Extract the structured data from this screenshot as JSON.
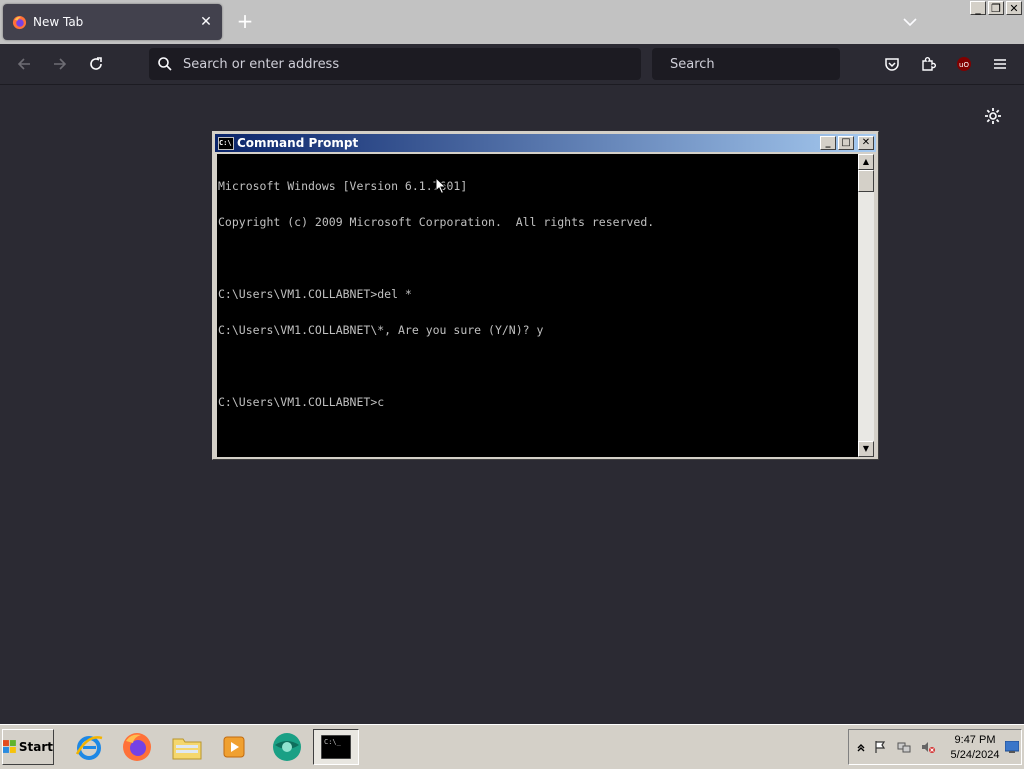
{
  "browser": {
    "tab": {
      "title": "New Tab"
    },
    "address_bar": {
      "placeholder": "Search or enter address"
    },
    "search_bar": {
      "placeholder": "Search"
    }
  },
  "cmd_window": {
    "title": "Command Prompt",
    "lines": [
      "Microsoft Windows [Version 6.1.7601]",
      "Copyright (c) 2009 Microsoft Corporation.  All rights reserved.",
      "",
      "C:\\Users\\VM1.COLLABNET>del *",
      "C:\\Users\\VM1.COLLABNET\\*, Are you sure (Y/N)? y",
      "",
      "C:\\Users\\VM1.COLLABNET>c"
    ]
  },
  "taskbar": {
    "start_label": "Start",
    "apps": [
      "internet-explorer",
      "firefox",
      "file-explorer",
      "media-player",
      "app-globe",
      "command-prompt"
    ],
    "clock_time": "9:47 PM",
    "clock_date": "5/24/2024"
  },
  "colors": {
    "page_bg": "#2b2a33",
    "console_bg": "#000000",
    "console_text": "#c0c0c0",
    "titlebar_start": "#0a246a",
    "titlebar_end": "#a6caf0"
  }
}
